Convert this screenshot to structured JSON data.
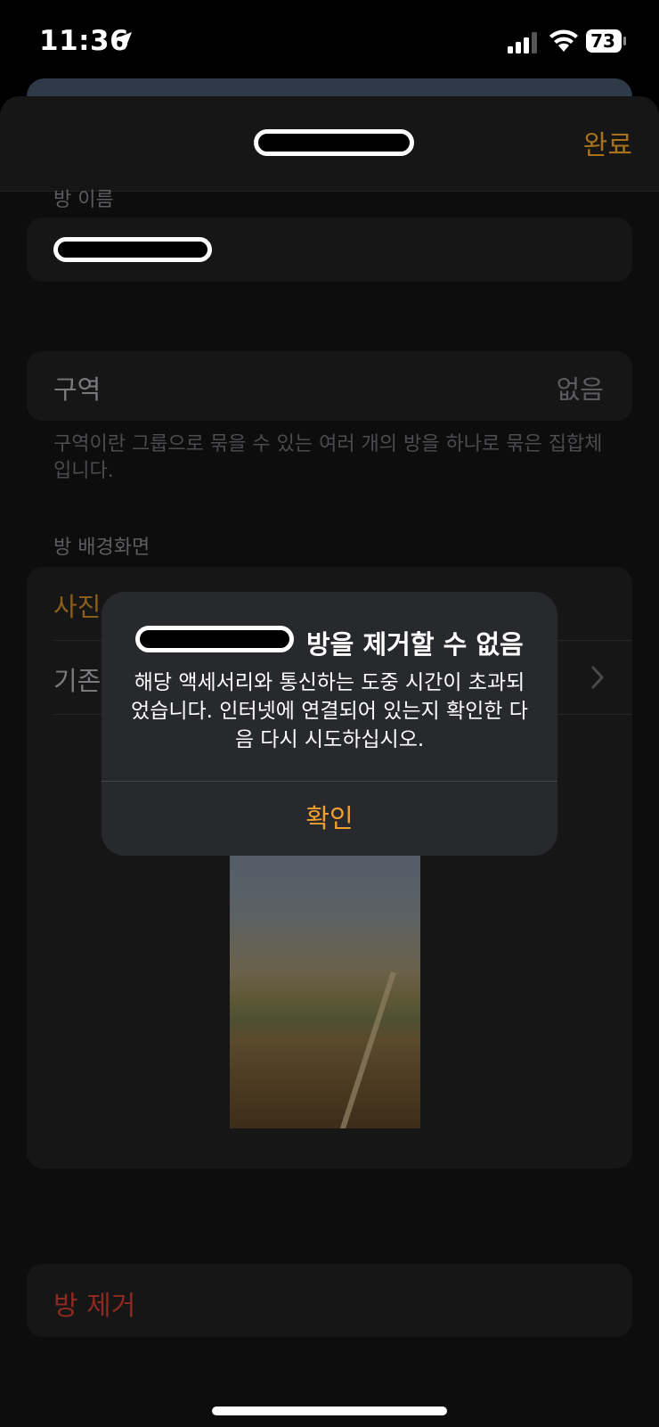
{
  "status_bar": {
    "time": "11:36",
    "battery": "73",
    "location_icon": "location-arrow-icon",
    "signal_icon": "cellular-signal-icon",
    "wifi_icon": "wifi-icon",
    "battery_icon": "battery-icon"
  },
  "nav": {
    "done_label": "완료"
  },
  "room_name": {
    "section_label": "방 이름"
  },
  "zone": {
    "label": "구역",
    "value": "없음",
    "footnote": "구역이란 그룹으로 묶을 수 있는 여러 개의 방을 하나로 묶은 집합체입니다."
  },
  "wallpaper": {
    "section_label": "방 배경화면",
    "take_photo_label": "사진",
    "existing_label": "기존"
  },
  "remove": {
    "label": "방 제거"
  },
  "alert": {
    "title": "방을 제거할 수 없음",
    "message": "해당 액세서리와 통신하는 도중 시간이 초과되었습니다. 인터넷에 연결되어 있는지 확인한 다음 다시 시도하십시오.",
    "ok_label": "확인"
  },
  "colors": {
    "accent": "#a8721a",
    "alert_accent": "#f0a030",
    "destructive": "#8c2a22"
  }
}
